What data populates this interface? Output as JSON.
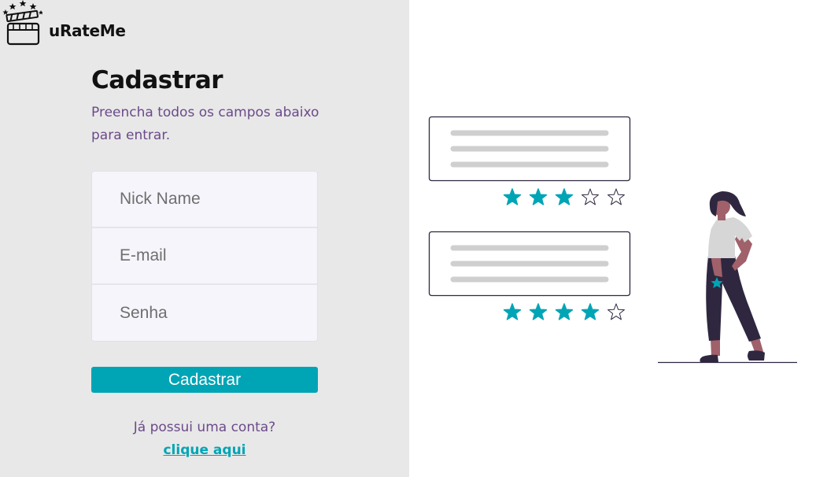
{
  "app": {
    "name": "uRateMe"
  },
  "signup": {
    "title": "Cadastrar",
    "subtitle": "Preencha todos os campos abaixo para entrar.",
    "fields": [
      {
        "placeholder": "Nick Name",
        "value": ""
      },
      {
        "placeholder": "E-mail",
        "value": ""
      },
      {
        "placeholder": "Senha",
        "value": ""
      }
    ],
    "submit_label": "Cadastrar",
    "login_prompt": "Já possui uma conta?",
    "login_link": "clique aqui"
  },
  "illustration": {
    "reviews": [
      {
        "rating": 3,
        "max": 5
      },
      {
        "rating": 4,
        "max": 5
      }
    ]
  },
  "colors": {
    "accent": "#00a5b5",
    "text_purple": "#6b4a8a",
    "left_bg": "#e8e8e8",
    "figure_dark": "#2f2740",
    "skin": "#a0616a",
    "shirt": "#d6d6d6"
  }
}
